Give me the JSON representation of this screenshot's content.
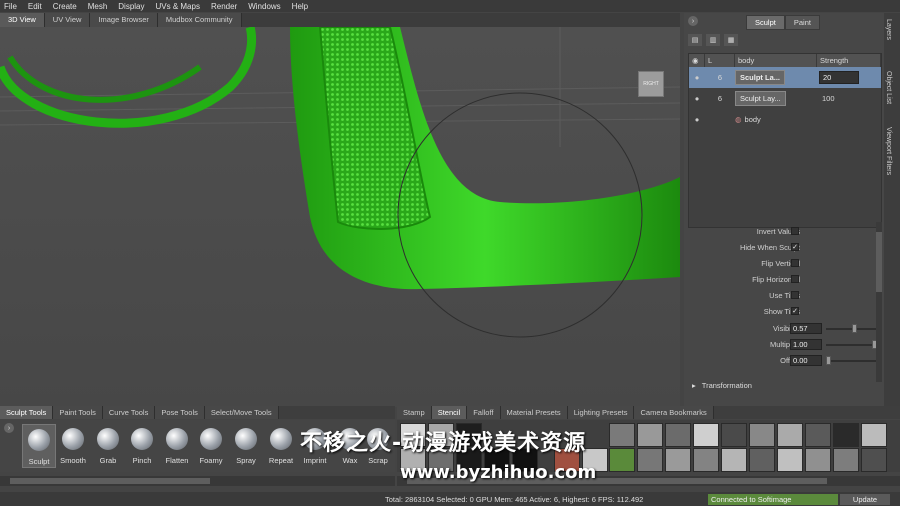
{
  "menu": [
    "File",
    "Edit",
    "Create",
    "Mesh",
    "Display",
    "UVs & Maps",
    "Render",
    "Windows",
    "Help"
  ],
  "view_tabs": [
    "3D View",
    "UV View",
    "Image Browser",
    "Mudbox Community"
  ],
  "view_cube_label": "RIGHT",
  "panel_tabs": [
    "Sculpt",
    "Paint"
  ],
  "layers": {
    "headers": [
      "L",
      "body",
      "Strength"
    ],
    "rows": [
      {
        "level": "6",
        "name": "Sculpt La...",
        "strength": "20"
      },
      {
        "level": "6",
        "name": "Sculpt Lay...",
        "strength": "100"
      },
      {
        "name": "body"
      }
    ]
  },
  "properties": {
    "invert_values": "Invert Values",
    "hide_when_sculpt": "Hide When Sculpt",
    "flip_vertical": "Flip Vertical",
    "flip_horizontal": "Flip Horizontal",
    "use_tiles": "Use Tiles",
    "show_tiles": "Show Tiles",
    "visibility_label": "Visibility",
    "visibility_value": "0.57",
    "multiplier_label": "Multiplier",
    "multiplier_value": "1.00",
    "offset_label": "Offset",
    "offset_value": "0.00",
    "transformation": "Transformation",
    "check_mark": "✓"
  },
  "side_tabs": [
    "Layers",
    "Object List",
    "Viewport Filters"
  ],
  "bottom_tabs_left": [
    "Sculpt Tools",
    "Paint Tools",
    "Curve Tools",
    "Pose Tools",
    "Select/Move Tools"
  ],
  "bottom_tabs_right": [
    "Stamp",
    "Stencil",
    "Falloff",
    "Material Presets",
    "Lighting Presets",
    "Camera Bookmarks"
  ],
  "tools": [
    "Sculpt",
    "Smooth",
    "Grab",
    "Pinch",
    "Flatten",
    "Foamy",
    "Spray",
    "Repeat",
    "Imprint",
    "Wax",
    "Scrap"
  ],
  "status": {
    "text": "Total: 2863104  Selected: 0 GPU Mem: 465  Active: 6, Highest: 6  FPS: 112.492",
    "connected": "Connected to Softimage",
    "update": "Update"
  },
  "watermark": {
    "cn": "不移之火-动漫游戏美术资源",
    "url": "www.byzhihuo.com"
  },
  "colors": {
    "accent_selection": "#6e8aad",
    "model_green": "#2fbf1a",
    "connected_green": "#5b8a3c"
  }
}
